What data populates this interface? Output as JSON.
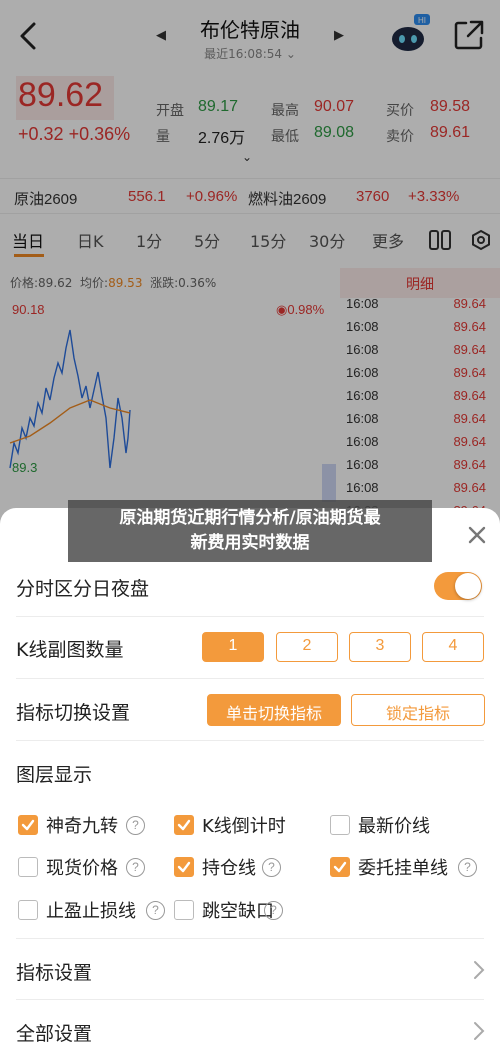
{
  "header": {
    "title": "布伦特原油",
    "subtitle": "最近16:08:54 ⌄",
    "badge": "HI"
  },
  "quote": {
    "price": "89.62",
    "change": "+0.32",
    "change_pct": "+0.36%",
    "open_label": "开盘",
    "open_value": "89.17",
    "high_label": "最高",
    "high_value": "90.07",
    "bid_label": "买价",
    "bid_value": "89.58",
    "volume_label": "量",
    "volume_value": "2.76万",
    "low_label": "最低",
    "low_value": "89.08",
    "ask_label": "卖价",
    "ask_value": "89.61"
  },
  "related": [
    {
      "name": "原油2609",
      "price": "556.1",
      "pct": "+0.96%"
    },
    {
      "name": "燃料油2609",
      "price": "3760",
      "pct": "+3.33%"
    }
  ],
  "tabs": [
    "当日",
    "日K",
    "1分",
    "5分",
    "15分",
    "30分",
    "更多"
  ],
  "chart_header": {
    "price_label": "价格:",
    "price_value": "89.62",
    "avg_label": "均价:",
    "avg_value": "89.53",
    "chg_label": "涨跌:",
    "chg_value": "0.36%",
    "top_value": "90.18",
    "top_pct": "0.98%",
    "low_value": "89.3"
  },
  "detail": {
    "title": "明细",
    "rows": [
      {
        "time": "16:08",
        "price": "89.64"
      },
      {
        "time": "16:08",
        "price": "89.64"
      },
      {
        "time": "16:08",
        "price": "89.64"
      },
      {
        "time": "16:08",
        "price": "89.64"
      },
      {
        "time": "16:08",
        "price": "89.64"
      },
      {
        "time": "16:08",
        "price": "89.64"
      },
      {
        "time": "16:08",
        "price": "89.64"
      },
      {
        "time": "16:08",
        "price": "89.64"
      },
      {
        "time": "16:08",
        "price": "89.64"
      },
      {
        "time": "16:08",
        "price": "89.64"
      }
    ]
  },
  "banner": {
    "line1": "原油期货近期行情分析/原油期货最",
    "line2": "新费用实时数据"
  },
  "sheet": {
    "night_label": "分时区分日夜盘",
    "night_on": true,
    "subchart_label": "K线副图数量",
    "subchart_options": [
      "1",
      "2",
      "3",
      "4"
    ],
    "subchart_selected": "1",
    "indicator_switch_label": "指标切换设置",
    "switch_click": "单击切换指标",
    "switch_lock": "锁定指标",
    "layers_label": "图层显示",
    "layers": [
      {
        "label": "神奇九转",
        "checked": true
      },
      {
        "label": "K线倒计时",
        "checked": true
      },
      {
        "label": "最新价线",
        "checked": false
      },
      {
        "label": "现货价格",
        "checked": false
      },
      {
        "label": "持仓线",
        "checked": true
      },
      {
        "label": "委托挂单线",
        "checked": true
      },
      {
        "label": "止盈止损线",
        "checked": false
      },
      {
        "label": "跳空缺口",
        "checked": false
      }
    ],
    "indicator_settings": "指标设置",
    "all_settings": "全部设置"
  }
}
